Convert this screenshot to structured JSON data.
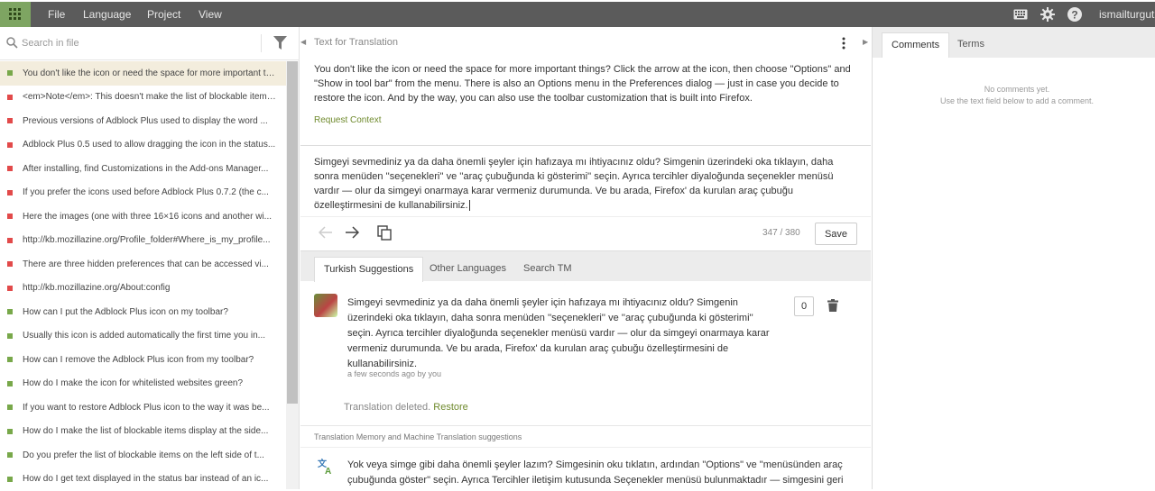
{
  "topbar": {
    "menu": [
      "File",
      "Language",
      "Project",
      "View"
    ],
    "username": "ismailturgut",
    "icons": [
      "apps-grid-icon",
      "keyboard-icon",
      "gear-icon",
      "help-icon"
    ]
  },
  "sidebar": {
    "search_placeholder": "Search in file",
    "items": [
      {
        "text": "You don't like the icon or need the space for more important things? Click...",
        "status": "ok",
        "active": true
      },
      {
        "text": "<em>Note</em>: This doesn't make the list of blockable items...",
        "status": "warn"
      },
      {
        "text": "Previous versions of Adblock Plus used to display the word ...",
        "status": "warn"
      },
      {
        "text": "Adblock Plus 0.5 used to allow dragging the icon in the status...",
        "status": "warn"
      },
      {
        "text": "After installing, find Customizations in the Add-ons Manager...",
        "status": "warn"
      },
      {
        "text": "If you prefer the icons used before Adblock Plus 0.7.2 (the c...",
        "status": "warn"
      },
      {
        "text": "Here the images (one with three 16×16 icons and another wi...",
        "status": "warn"
      },
      {
        "text": "http://kb.mozillazine.org/Profile_folder#Where_is_my_profile...",
        "status": "warn"
      },
      {
        "text": "There are three hidden preferences that can be accessed vi...",
        "status": "warn"
      },
      {
        "text": "http://kb.mozillazine.org/About:config",
        "status": "warn"
      },
      {
        "text": "How can I put the Adblock Plus icon on my toolbar?",
        "status": "ok"
      },
      {
        "text": "Usually this icon is added automatically the first time you in...",
        "status": "ok"
      },
      {
        "text": "How can I remove the Adblock Plus icon from my toolbar?",
        "status": "ok"
      },
      {
        "text": "How do I make the icon for whitelisted websites green?",
        "status": "ok"
      },
      {
        "text": "If you want to restore Adblock Plus icon to the way it was be...",
        "status": "ok"
      },
      {
        "text": "How do I make the list of blockable items display at the side...",
        "status": "ok"
      },
      {
        "text": "Do you prefer the list of blockable items on the left side of t...",
        "status": "ok"
      },
      {
        "text": "How do I get text displayed in the status bar instead of an ic...",
        "status": "ok"
      }
    ]
  },
  "editor": {
    "source_header": "Text for Translation",
    "source_text": "You don't like the icon or need the space for more important things? Click the arrow at the icon, then choose \"Options\" and \"Show in tool bar\" from the menu. There is also an Options menu in the Preferences dialog — just in case you decide to restore the icon. And by the way, you can also use the toolbar customization that is built into Firefox.",
    "request_context": "Request Context",
    "translation_text": "Simgeyi sevmediniz ya da daha önemli şeyler için hafızaya mı ihtiyacınız oldu? Simgenin üzerindeki oka tıklayın, daha sonra menüden ''seçenekleri'' ve ''araç çubuğunda ki gösterimi'' seçin. Ayrıca tercihler diyaloğunda seçenekler menüsü vardır — olur da simgeyi onarmaya karar vermeniz durumunda. Ve bu arada, Firefox' da kurulan araç çubuğu özelleştirmesini de kullanabilirsiniz.",
    "char_count": "347 / 380",
    "save_label": "Save"
  },
  "suggestions": {
    "tabs": [
      "Turkish Suggestions",
      "Other Languages",
      "Search TM"
    ],
    "item_text": "Simgeyi sevmediniz ya da daha önemli şeyler için hafızaya mı ihtiyacınız oldu? Simgenin üzerindeki oka tıklayın, daha sonra menüden ''seçenekleri'' ve ''araç çubuğunda ki gösterimi'' seçin. Ayrıca tercihler diyaloğunda seçenekler menüsü vardır — olur da simgeyi onarmaya karar vermeniz durumunda. Ve bu arada, Firefox' da kurulan araç çubuğu özelleştirmesini de kullanabilirsiniz.",
    "item_meta": "a few seconds ago by you",
    "vote_count": "0",
    "deleted_msg": "Translation deleted.",
    "restore_label": "Restore",
    "tm_header": "Translation Memory and Machine Translation suggestions",
    "tm_text": "Yok veya simge gibi daha önemli şeyler lazım? Simgesinin oku tıklatın, ardından \"Options\" ve \"menüsünden araç çubuğunda göster\" seçin. Ayrıca Tercihler iletişim kutusunda Seçenekler menüsü bulunmaktadır — simgesini geri"
  },
  "comments_panel": {
    "tabs": [
      "Comments",
      "Terms"
    ],
    "empty_line1": "No comments yet.",
    "empty_line2": "Use the text field below to add a comment."
  },
  "colors": {
    "accent": "#6f8a2d",
    "ok": "#78a84a",
    "warn": "#e24a4a",
    "topbar": "#5b5b5b",
    "apps": "#7ea562"
  }
}
